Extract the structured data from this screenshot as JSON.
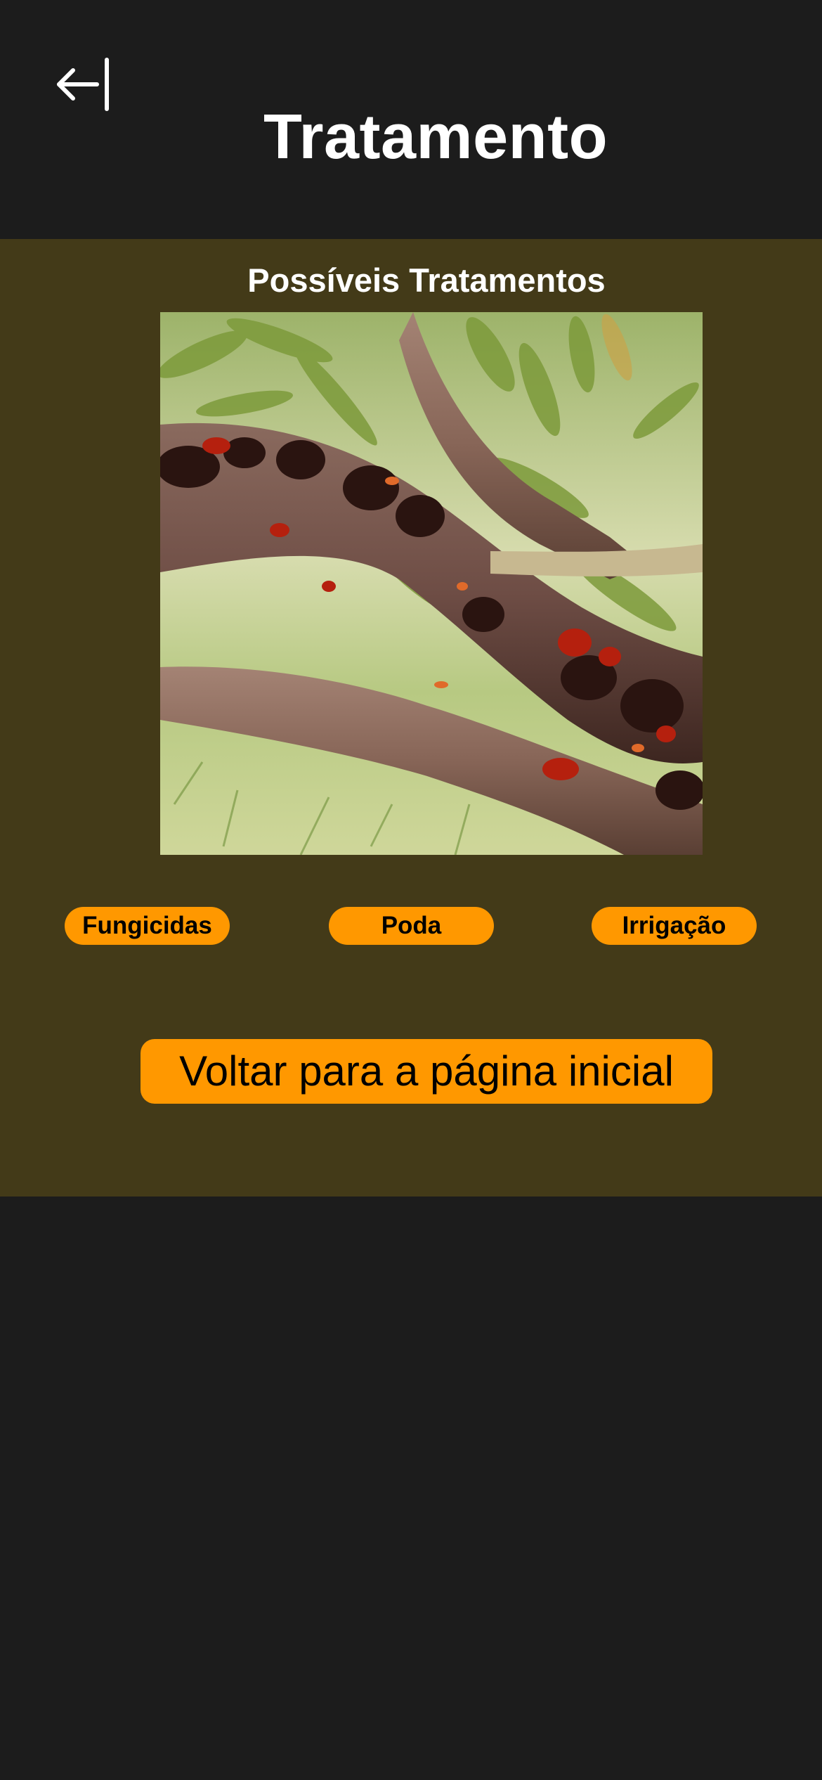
{
  "header": {
    "title": "Tratamento",
    "back_icon": "arrow-left-to-line-icon"
  },
  "content": {
    "section_title": "Possíveis Tratamentos",
    "image_subject": "tree-branch-with-gum-disease-photo"
  },
  "treatments": [
    {
      "label": "Fungicidas"
    },
    {
      "label": "Poda"
    },
    {
      "label": "Irrigação"
    }
  ],
  "actions": {
    "home_button_label": "Voltar para a página inicial"
  },
  "colors": {
    "background": "#1c1c1c",
    "panel": "#433a18",
    "accent": "#ff9800",
    "title_text": "#ffffff",
    "button_text": "#000000"
  }
}
